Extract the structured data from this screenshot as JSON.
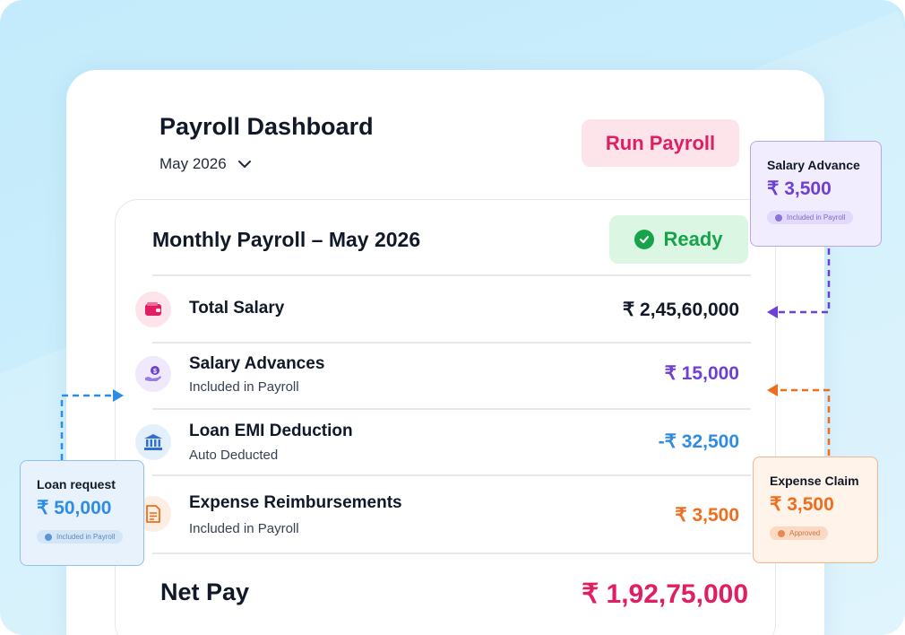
{
  "header": {
    "title": "Payroll Dashboard",
    "month": "May 2026",
    "run_button": "Run Payroll"
  },
  "summary": {
    "title": "Monthly Payroll – May 2026",
    "status": "Ready",
    "rows": [
      {
        "title": "Total Salary",
        "subtitle": "",
        "amount": "₹ 2,45,60,000",
        "color": "#111827",
        "icon": "wallet-icon"
      },
      {
        "title": "Salary Advances",
        "subtitle": "Included in Payroll",
        "amount": "₹ 15,000",
        "color": "#6d3fd6",
        "icon": "hand-coin-icon"
      },
      {
        "title": "Loan EMI Deduction",
        "subtitle": "Auto Deducted",
        "amount": "-₹ 32,500",
        "color": "#2f8ce6",
        "icon": "bank-icon"
      },
      {
        "title": "Expense Reimbursements",
        "subtitle": "Included in Payroll",
        "amount": "₹ 3,500",
        "color": "#ef6d1d",
        "icon": "document-icon"
      }
    ],
    "net_pay_label": "Net Pay",
    "net_pay_amount": "₹ 1,92,75,000"
  },
  "side_cards": {
    "salary_advance": {
      "title": "Salary Advance",
      "amount": "₹ 3,500",
      "chip": "Included in Payroll",
      "color": "#6d3fd6"
    },
    "loan_request": {
      "title": "Loan request",
      "amount": "₹ 50,000",
      "chip": "Included in Payroll",
      "color": "#2f8ce6"
    },
    "expense_claim": {
      "title": "Expense Claim",
      "amount": "₹ 3,500",
      "chip": "Approved",
      "color": "#ef6d1d"
    }
  },
  "colors": {
    "accent_pink": "#e11d63",
    "ready_green": "#16a34a",
    "background_blue": "#c3ebfb"
  }
}
